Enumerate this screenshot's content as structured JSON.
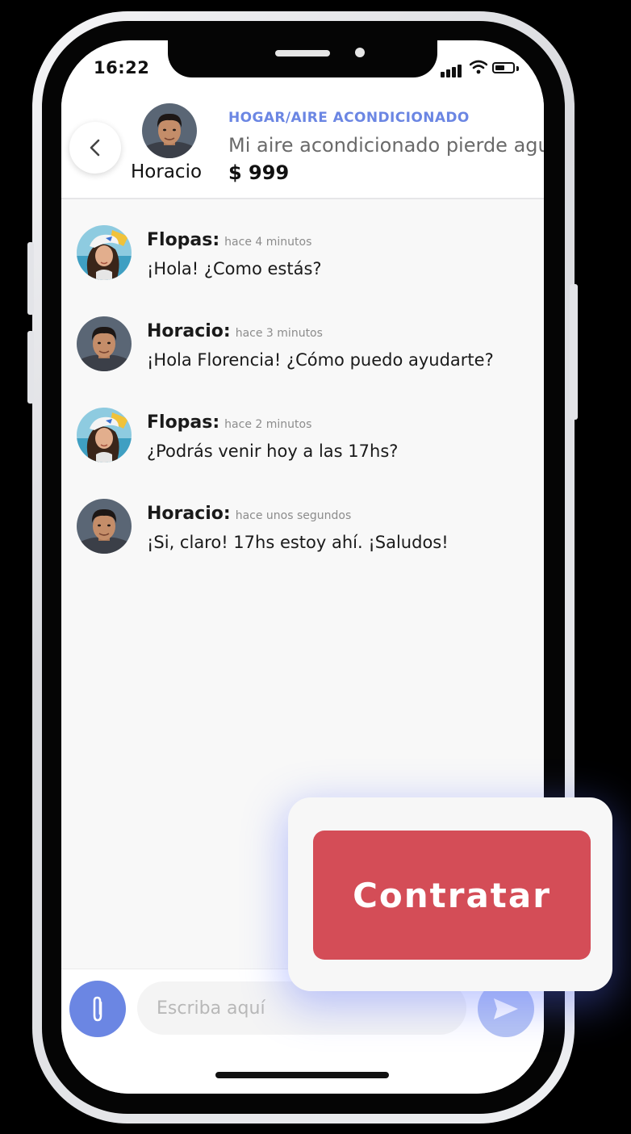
{
  "status_bar": {
    "time": "16:22"
  },
  "header": {
    "contact_name": "Horacio",
    "category": "HOGAR/AIRE ACONDICIONADO",
    "title": "Mi aire acondicionado pierde agua",
    "price": "$ 999"
  },
  "messages": [
    {
      "author": "Flopas:",
      "time": "hace 4 minutos",
      "text": "¡Hola! ¿Como estás?",
      "avatar": "woman-avatar"
    },
    {
      "author": "Horacio:",
      "time": "hace 3 minutos",
      "text": "¡Hola Florencia! ¿Cómo puedo ayudarte?",
      "avatar": "man-avatar"
    },
    {
      "author": "Flopas:",
      "time": "hace 2 minutos",
      "text": "¿Podrás venir hoy a las 17hs?",
      "avatar": "woman-avatar"
    },
    {
      "author": "Horacio:",
      "time": "hace unos segundos",
      "text": "¡Si, claro! 17hs estoy ahí. ¡Saludos!",
      "avatar": "man-avatar"
    }
  ],
  "composer": {
    "placeholder": "Escriba aquí",
    "value": ""
  },
  "cta": {
    "label": "Contratar"
  },
  "colors": {
    "accent": "#6b86e3",
    "send_button": "#b6c4f3",
    "cta": "#d44d57",
    "chat_background": "#f8f8f8"
  }
}
